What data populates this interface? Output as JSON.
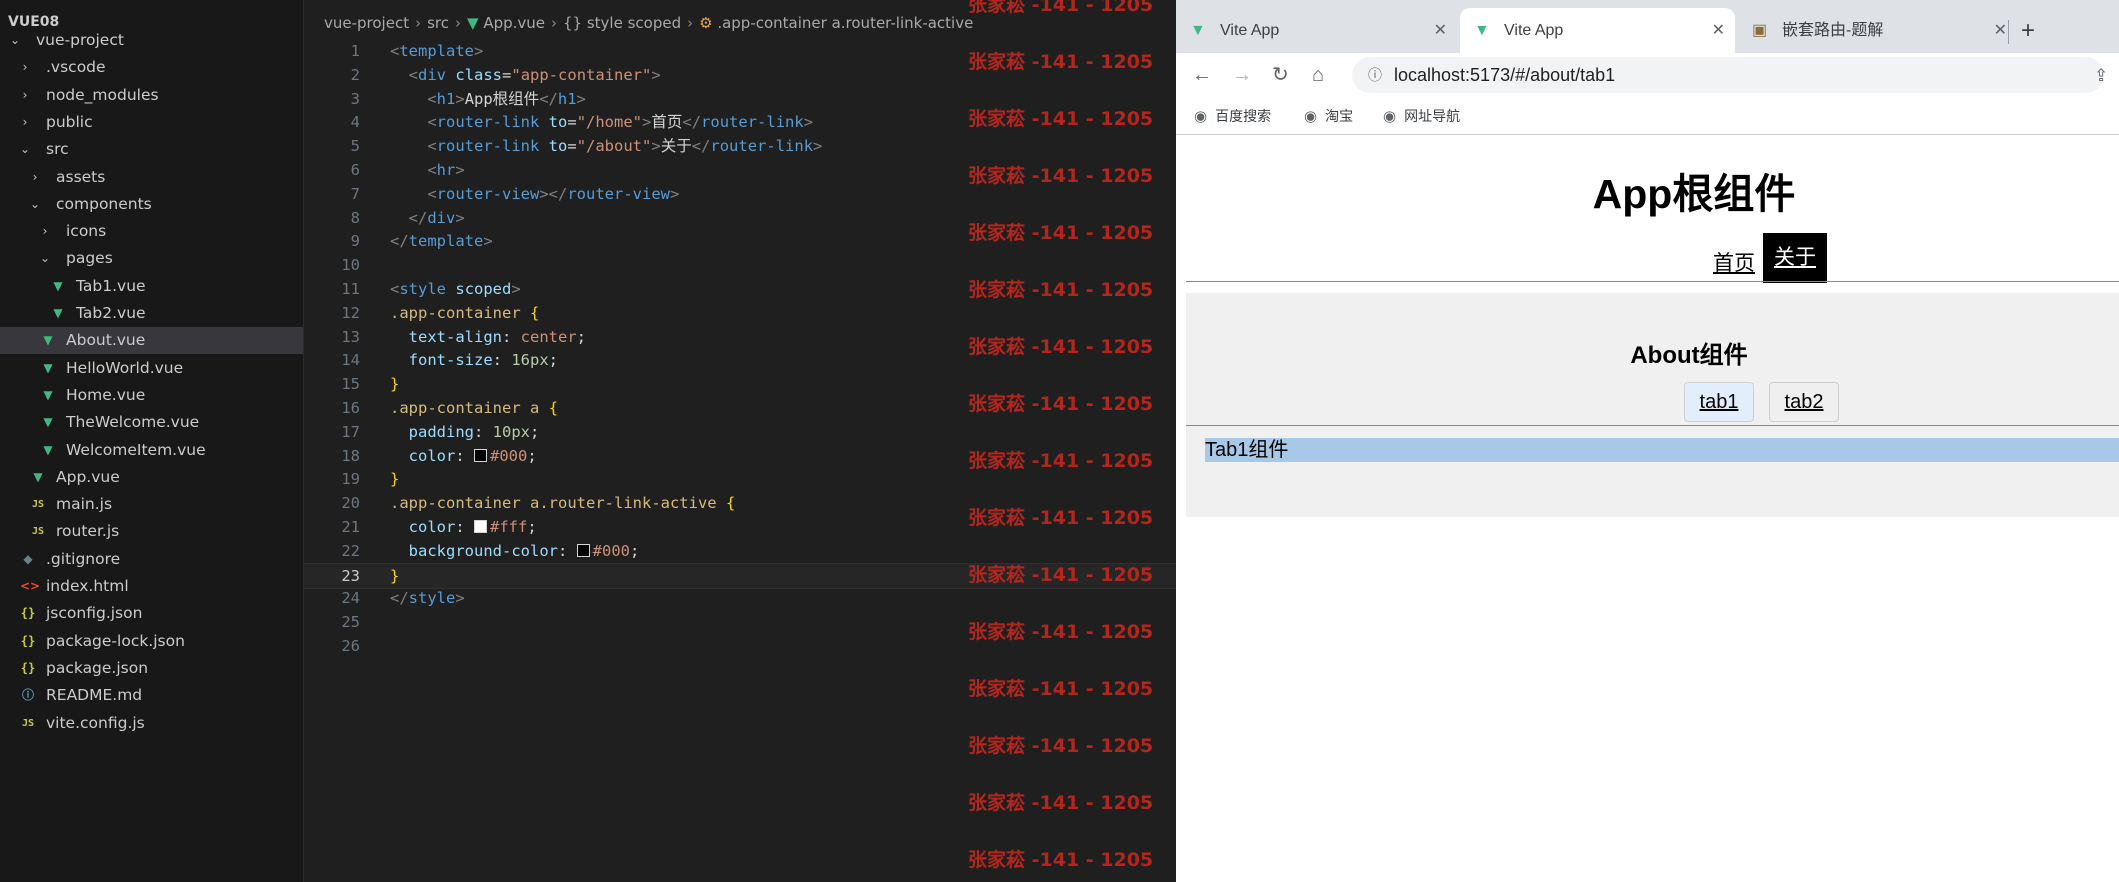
{
  "explorer": {
    "root": "VUE08",
    "items": [
      {
        "name": "vue-project",
        "type": "folder-open"
      },
      {
        "name": ".vscode",
        "type": "folder"
      },
      {
        "name": "node_modules",
        "type": "folder"
      },
      {
        "name": "public",
        "type": "folder"
      },
      {
        "name": "src",
        "type": "folder-open"
      },
      {
        "name": "assets",
        "type": "folder"
      },
      {
        "name": "components",
        "type": "folder-open"
      },
      {
        "name": "icons",
        "type": "folder"
      },
      {
        "name": "pages",
        "type": "folder-open"
      },
      {
        "name": "Tab1.vue",
        "type": "vue"
      },
      {
        "name": "Tab2.vue",
        "type": "vue"
      },
      {
        "name": "About.vue",
        "type": "vue",
        "selected": true
      },
      {
        "name": "HelloWorld.vue",
        "type": "vue"
      },
      {
        "name": "Home.vue",
        "type": "vue"
      },
      {
        "name": "TheWelcome.vue",
        "type": "vue"
      },
      {
        "name": "WelcomeItem.vue",
        "type": "vue"
      },
      {
        "name": "App.vue",
        "type": "vue"
      },
      {
        "name": "main.js",
        "type": "js"
      },
      {
        "name": "router.js",
        "type": "js"
      },
      {
        "name": ".gitignore",
        "type": "git"
      },
      {
        "name": "index.html",
        "type": "html"
      },
      {
        "name": "jsconfig.json",
        "type": "json"
      },
      {
        "name": "package-lock.json",
        "type": "json"
      },
      {
        "name": "package.json",
        "type": "json"
      },
      {
        "name": "README.md",
        "type": "info"
      },
      {
        "name": "vite.config.js",
        "type": "js"
      }
    ],
    "icons": {
      "chevron_right": "›",
      "chevron_down": "⌄",
      "vue": "▼",
      "js": "JS",
      "json": "{}",
      "git": "◆",
      "html": "<>",
      "info": "ⓘ"
    }
  },
  "editor": {
    "breadcrumb": [
      "vue-project",
      "src",
      "App.vue",
      "{} style scoped",
      ".app-container a.router-link-active"
    ],
    "current_line": 23,
    "watermark": "张家菘 -141 - 1205",
    "swatch_colors": [
      "#000000",
      "#ffffff",
      "#000000"
    ]
  },
  "browser": {
    "tabs": [
      {
        "title": "Vite App",
        "active": false
      },
      {
        "title": "Vite App",
        "active": true
      },
      {
        "title": "嵌套路由-题解",
        "active": false
      }
    ],
    "close_glyph": "✕",
    "new_tab_glyph": "+",
    "nav": {
      "back": "←",
      "forward": "→",
      "reload": "↻",
      "home": "⌂",
      "share": "⇪"
    },
    "url": "localhost:5173/#/about/tab1",
    "bookmarks": [
      "百度搜索",
      "淘宝",
      "网址导航"
    ],
    "page": {
      "title": "App根组件",
      "nav_home": "首页",
      "nav_about": "关于",
      "about_title": "About组件",
      "sub_tab1": "tab1",
      "sub_tab2": "tab2",
      "tab1_content": "Tab1组件"
    },
    "colors": {
      "active_link_bg": "#000000",
      "active_link_text": "#ffffff",
      "about_bg": "#f0f0f0",
      "tab_content_highlight": "#a8c8e8"
    }
  }
}
